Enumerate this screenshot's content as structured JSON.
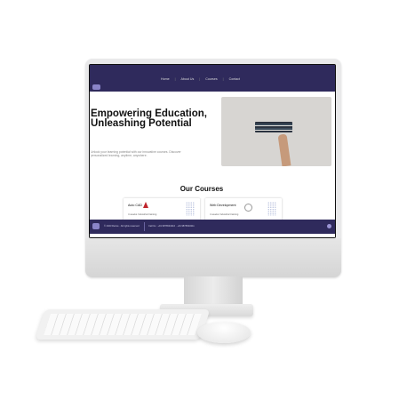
{
  "nav": {
    "links": [
      "Home",
      "About Us",
      "Courses",
      "Contact"
    ]
  },
  "hero": {
    "title": "Empowering Education, Unleashing Potential",
    "subtitle": "Unlock your learning potential with our innovative courses. Discover personalized learning, anytime, anywhere."
  },
  "courses": {
    "heading": "Our Courses",
    "items": [
      {
        "name": "Auto CAD",
        "desc": "4 weeks Industrial training"
      },
      {
        "name": "Web Development",
        "desc": "4 weeks Industrial training"
      }
    ]
  },
  "footer": {
    "copyright": "© 2023 Derive · All rights reserved",
    "contact": "Call Us : +91 9876543210 · +91 9876543211"
  },
  "colors": {
    "brand": "#2f2a5c",
    "accent": "#8a84c9",
    "autocad_icon": "#c0262d"
  }
}
